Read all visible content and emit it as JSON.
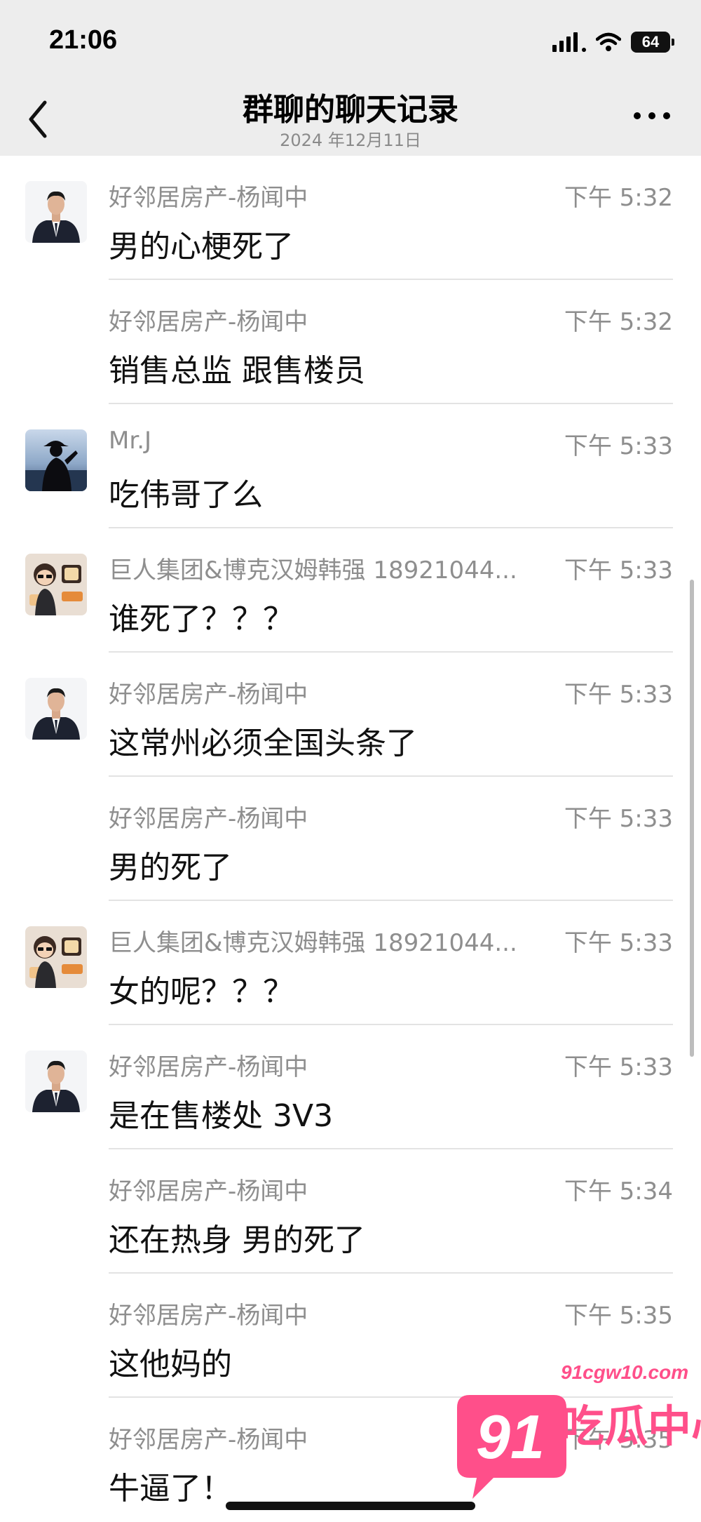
{
  "status_bar": {
    "time": "21:06",
    "battery": "64"
  },
  "nav": {
    "title": "群聊的聊天记录",
    "subtitle": "2024 年12月11日"
  },
  "messages": [
    {
      "name": "好邻居房产-杨闻中",
      "time": "下午 5:32",
      "text": "男的心梗死了",
      "avatar": "suit-man"
    },
    {
      "name": "好邻居房产-杨闻中",
      "time": "下午 5:32",
      "text": "销售总监 跟售楼员",
      "avatar": ""
    },
    {
      "name": "Mr.J",
      "time": "下午 5:33",
      "text": "吃伟哥了么",
      "avatar": "silhouette"
    },
    {
      "name": "巨人集团&博克汉姆韩强 18921044...",
      "time": "下午 5:33",
      "text": "谁死了？？？",
      "avatar": "cartoon"
    },
    {
      "name": "好邻居房产-杨闻中",
      "time": "下午 5:33",
      "text": "这常州必须全国头条了",
      "avatar": "suit-man"
    },
    {
      "name": "好邻居房产-杨闻中",
      "time": "下午 5:33",
      "text": "男的死了",
      "avatar": ""
    },
    {
      "name": "巨人集团&博克汉姆韩强 18921044...",
      "time": "下午 5:33",
      "text": "女的呢？？？",
      "avatar": "cartoon"
    },
    {
      "name": "好邻居房产-杨闻中",
      "time": "下午 5:33",
      "text": "是在售楼处 3V3",
      "avatar": "suit-man"
    },
    {
      "name": "好邻居房产-杨闻中",
      "time": "下午 5:34",
      "text": "还在热身 男的死了",
      "avatar": ""
    },
    {
      "name": "好邻居房产-杨闻中",
      "time": "下午 5:35",
      "text": "这他妈的",
      "avatar": ""
    },
    {
      "name": "好邻居房产-杨闻中",
      "time": "下午 5:35",
      "text": "牛逼了！",
      "avatar": ""
    }
  ],
  "watermark": {
    "logo": "91",
    "url": "91cgw10.com",
    "name": "吃瓜中心"
  },
  "colors": {
    "watermark": "#ff4f8a",
    "header_bg": "#ededed",
    "meta_text": "#8e8e8e"
  }
}
